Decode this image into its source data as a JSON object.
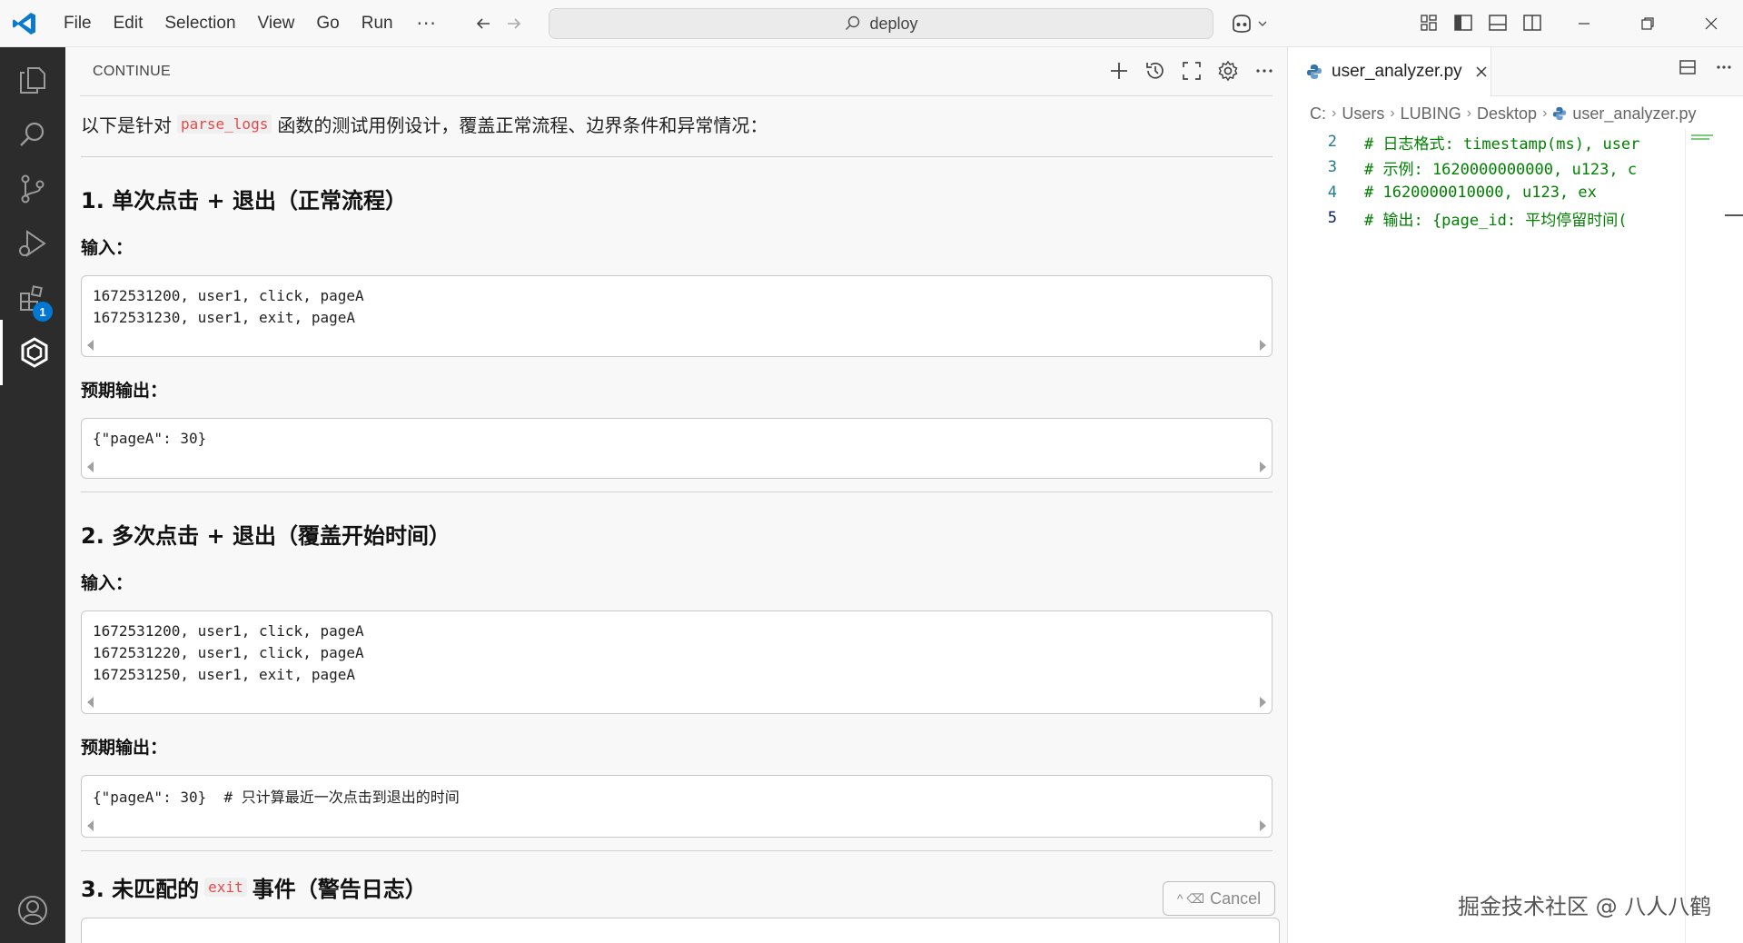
{
  "titlebar": {
    "menus": [
      "File",
      "Edit",
      "Selection",
      "View",
      "Go",
      "Run"
    ],
    "more": "···",
    "search_text": "deploy"
  },
  "activity": {
    "extensions_badge": "1"
  },
  "panel": {
    "title": "CONTINUE",
    "intro_before": "以下是针对",
    "intro_code": "parse_logs",
    "intro_after": "函数的测试用例设计，覆盖正常流程、边界条件和异常情况：",
    "sections": [
      {
        "heading": "1. 单次点击 + 退出（正常流程）",
        "input_label": "输入：",
        "input_lines": [
          "1672531200, user1, click, pageA",
          "1672531230, user1, exit, pageA"
        ],
        "output_label": "预期输出：",
        "output_lines": [
          "{\"pageA\": 30}"
        ]
      },
      {
        "heading": "2. 多次点击 + 退出（覆盖开始时间）",
        "input_label": "输入：",
        "input_lines": [
          "1672531200, user1, click, pageA",
          "1672531220, user1, click, pageA",
          "1672531250, user1, exit, pageA"
        ],
        "output_label": "预期输出：",
        "output_lines": [
          "{\"pageA\": 30}  # 只计算最近一次点击到退出的时间"
        ]
      }
    ],
    "section3": {
      "heading_prefix": "3. 未匹配的",
      "heading_code": "exit",
      "heading_suffix": "事件（警告日志）"
    },
    "cancel_label": "Cancel",
    "cancel_hint": "^ ⌫"
  },
  "editor": {
    "tab_label": "user_analyzer.py",
    "breadcrumbs": [
      "C:",
      "Users",
      "LUBING",
      "Desktop",
      "user_analyzer.py"
    ],
    "lines": [
      {
        "num": "2",
        "text": "# 日志格式: timestamp(ms), user"
      },
      {
        "num": "3",
        "text": "# 示例: 1620000000000, u123, c"
      },
      {
        "num": "4",
        "text": "#      1620000010000, u123, ex"
      },
      {
        "num": "5",
        "text": "# 输出: {page_id: 平均停留时间("
      }
    ]
  },
  "watermark": "掘金技术社区 @ 八人八鹤"
}
